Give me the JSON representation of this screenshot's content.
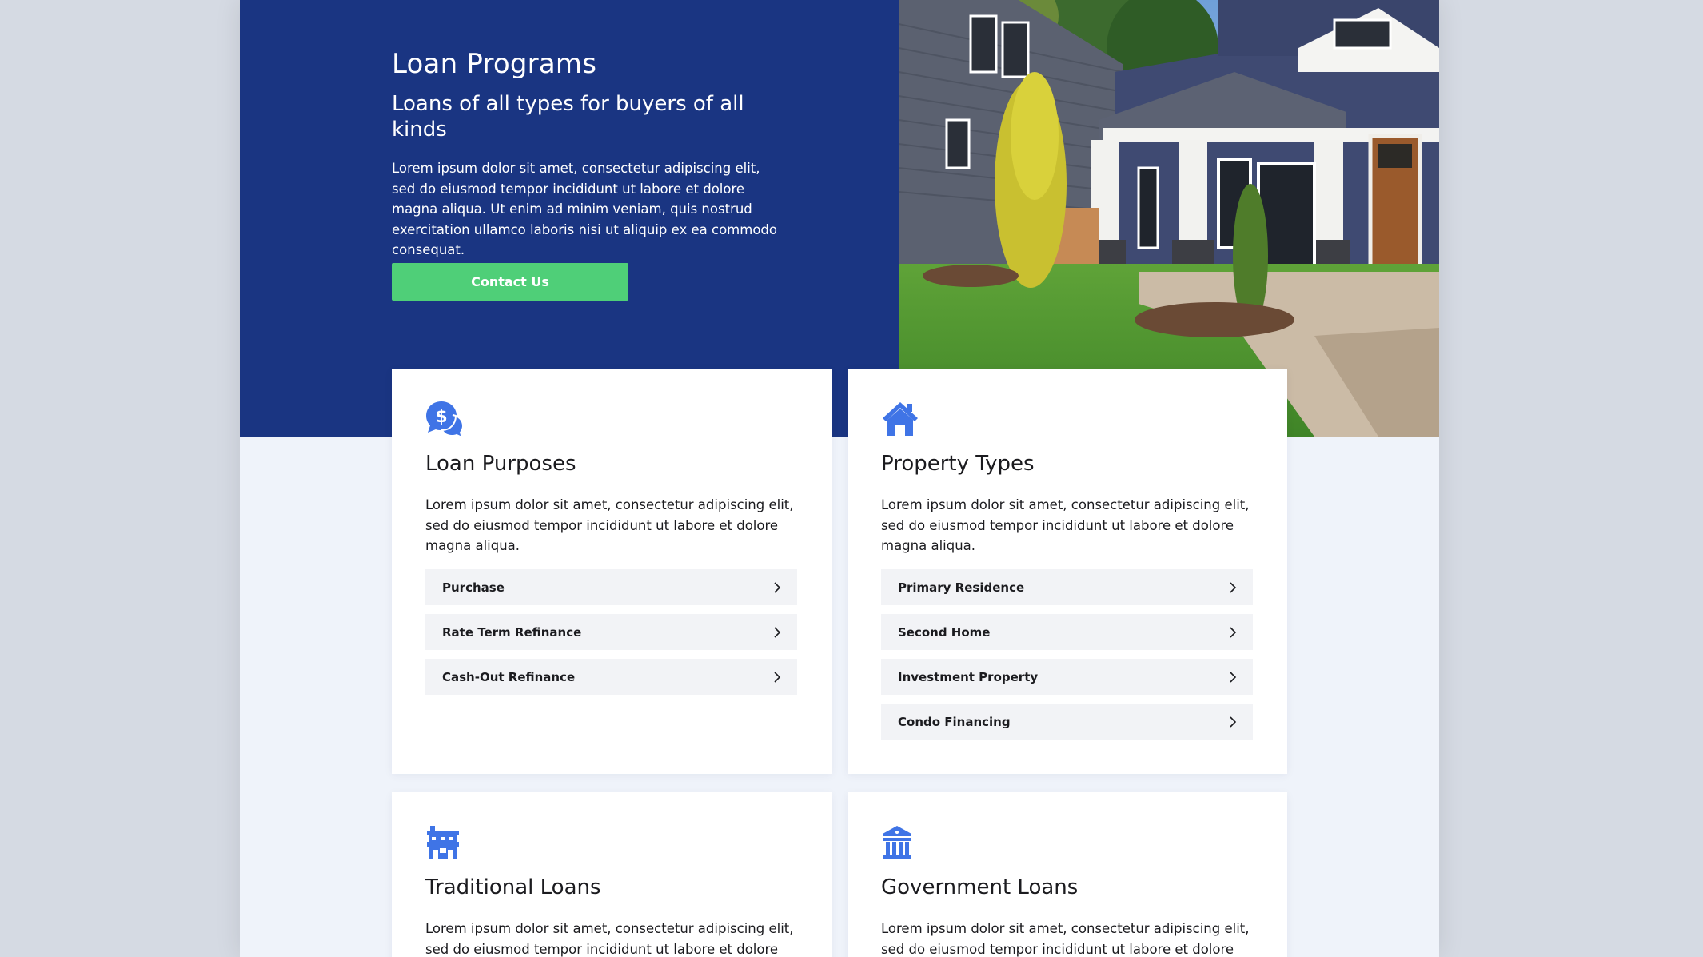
{
  "hero": {
    "title": "Loan Programs",
    "subtitle": "Loans of all types for buyers of all kinds",
    "body": "Lorem ipsum dolor sit amet, consectetur adipiscing elit, sed do eiusmod tempor incididunt ut labore et dolore magna aliqua. Ut enim ad minim veniam, quis nostrud exercitation ullamco laboris nisi ut aliquip ex ea commodo consequat.",
    "cta_label": "Contact Us"
  },
  "cards": [
    {
      "icon": "money-chat-icon",
      "title": "Loan Purposes",
      "description": "Lorem ipsum dolor sit amet, consectetur adipiscing elit, sed do eiusmod tempor incididunt ut labore et dolore magna aliqua.",
      "links": [
        "Purchase",
        "Rate Term Refinance",
        "Cash-Out Refinance"
      ]
    },
    {
      "icon": "house-icon",
      "title": "Property Types",
      "description": "Lorem ipsum dolor sit amet, consectetur adipiscing elit, sed do eiusmod tempor incididunt ut labore et dolore magna aliqua.",
      "links": [
        "Primary Residence",
        "Second Home",
        "Investment Property",
        "Condo Financing"
      ]
    },
    {
      "icon": "storefront-icon",
      "title": "Traditional Loans",
      "description": "Lorem ipsum dolor sit amet, consectetur adipiscing elit, sed do eiusmod tempor incididunt ut labore et dolore"
    },
    {
      "icon": "bank-building-icon",
      "title": "Government Loans",
      "description": "Lorem ipsum dolor sit amet, consectetur adipiscing elit, sed do eiusmod tempor incididunt ut labore et dolore"
    }
  ],
  "colors": {
    "hero_blue": "#1a3582",
    "cta_green": "#4fcf78",
    "icon_blue": "#3f74e6",
    "page_bg": "#eff3fa",
    "link_bg": "#f2f3f6"
  }
}
